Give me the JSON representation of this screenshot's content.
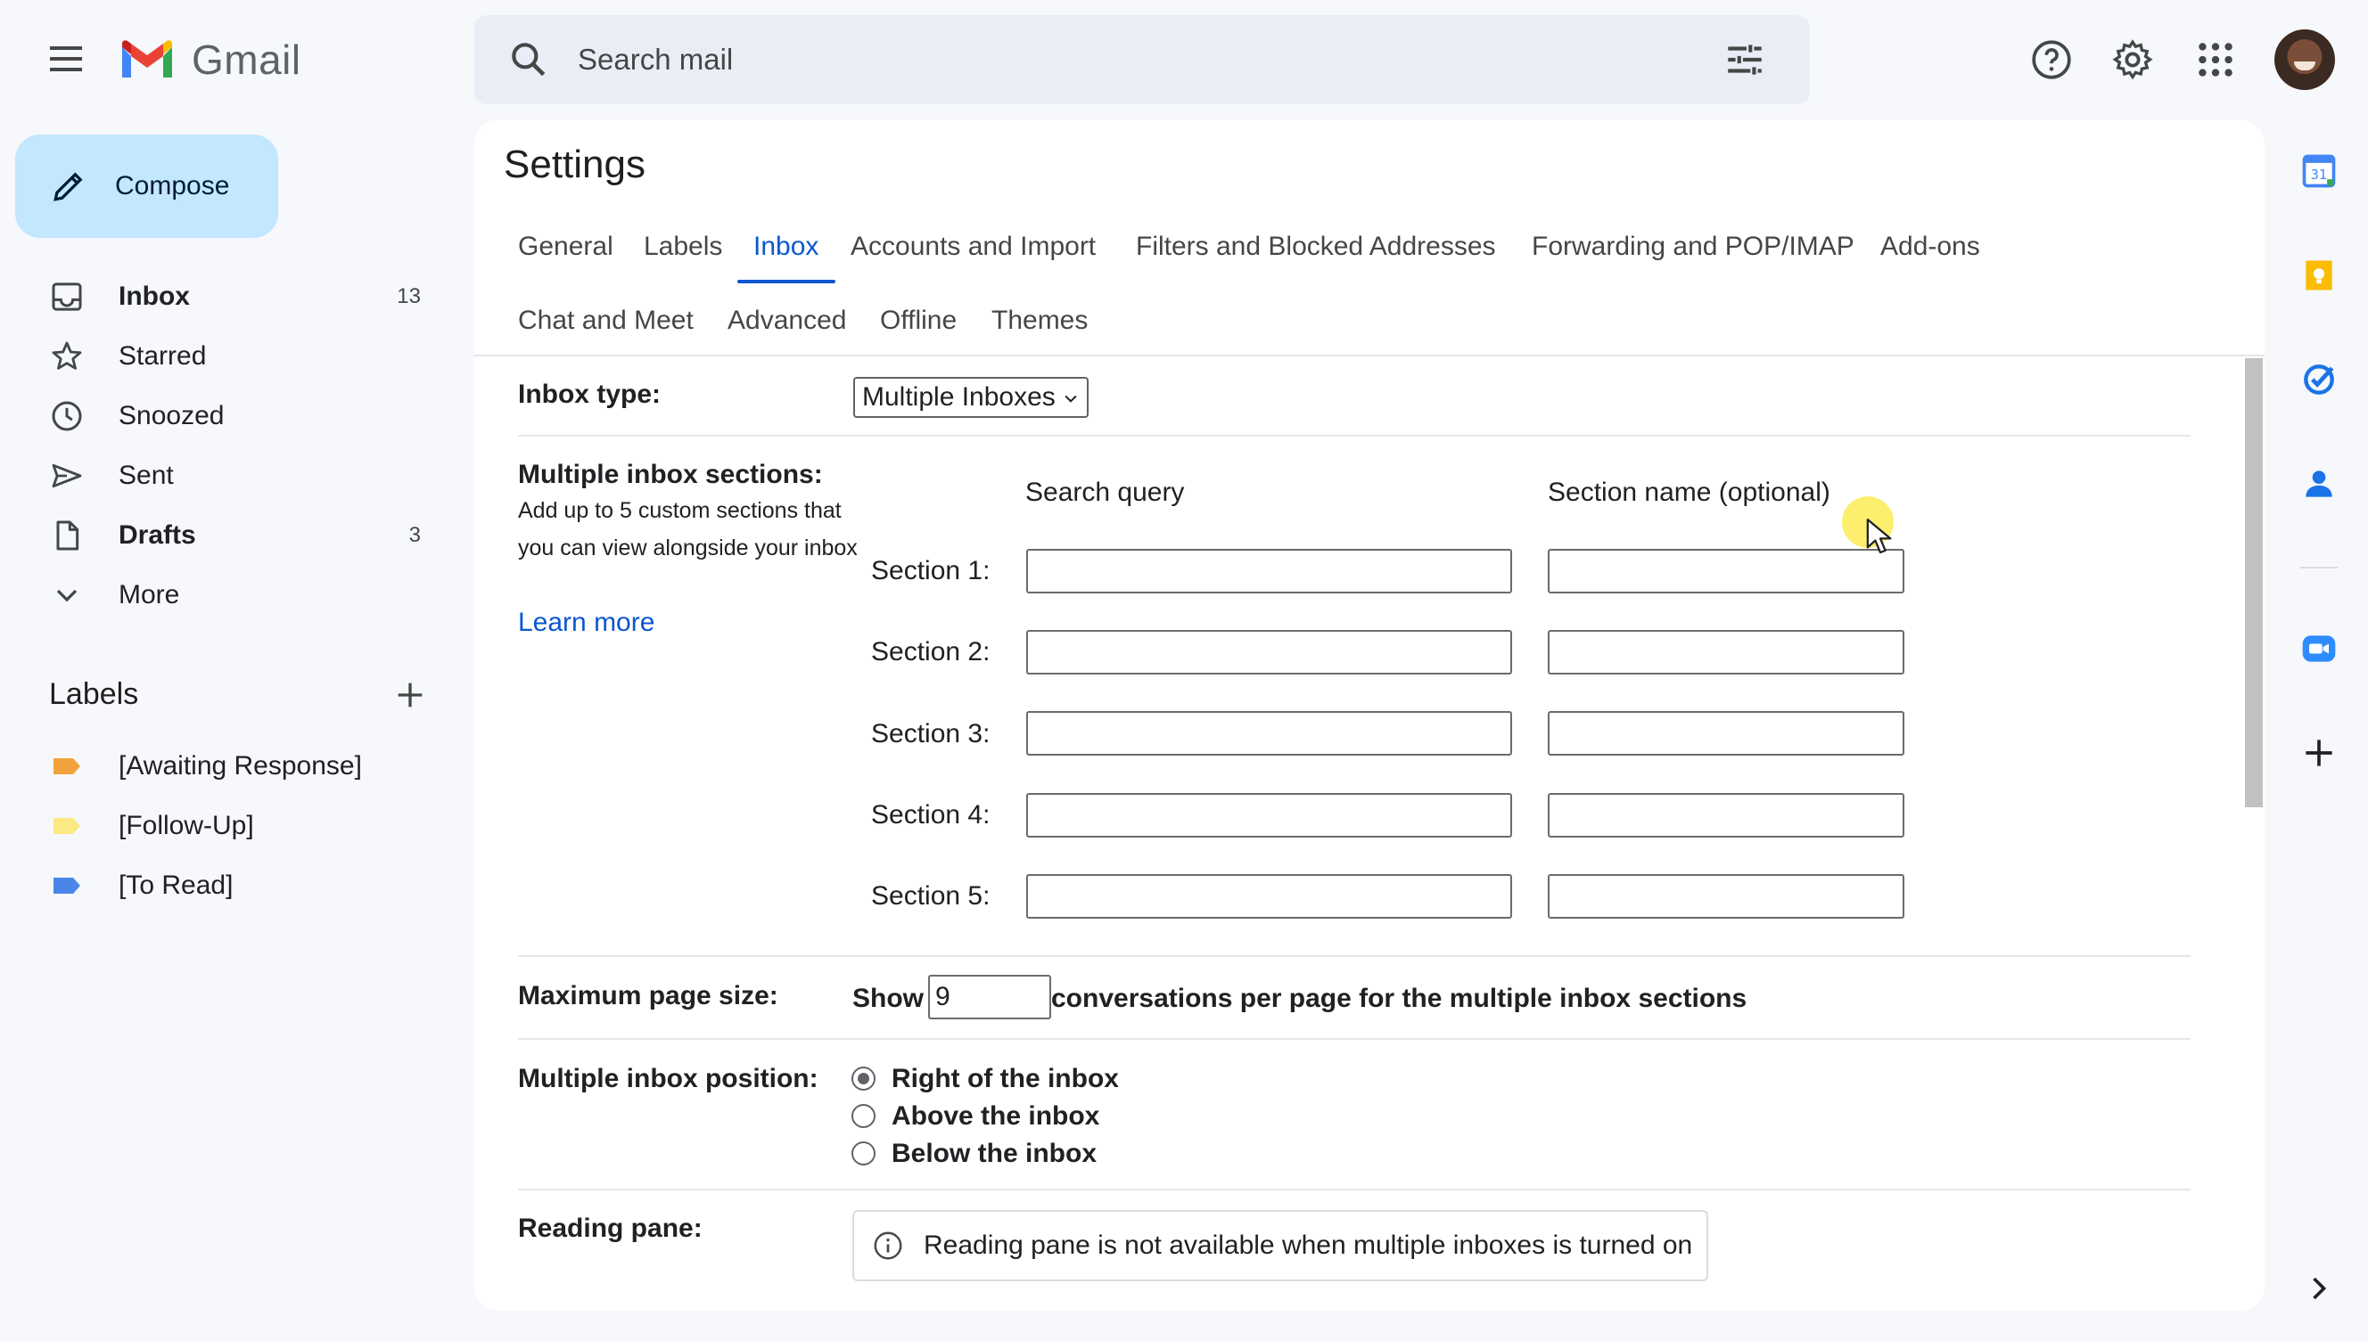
{
  "app": {
    "name": "Gmail"
  },
  "search": {
    "placeholder": "Search mail"
  },
  "compose": {
    "label": "Compose"
  },
  "nav": [
    {
      "label": "Inbox",
      "count": "13",
      "bold": true
    },
    {
      "label": "Starred",
      "count": ""
    },
    {
      "label": "Snoozed",
      "count": ""
    },
    {
      "label": "Sent",
      "count": ""
    },
    {
      "label": "Drafts",
      "count": "3",
      "bold": true
    },
    {
      "label": "More",
      "count": ""
    }
  ],
  "labels": {
    "title": "Labels",
    "items": [
      {
        "label": "[Awaiting Response]",
        "color": "#f2a23c"
      },
      {
        "label": "[Follow-Up]",
        "color": "#fbe983"
      },
      {
        "label": "[To Read]",
        "color": "#4a86e8"
      }
    ]
  },
  "settings": {
    "title": "Settings",
    "tabs": [
      "General",
      "Labels",
      "Inbox",
      "Accounts and Import",
      "Filters and Blocked Addresses",
      "Forwarding and POP/IMAP",
      "Add-ons",
      "Chat and Meet",
      "Advanced",
      "Offline",
      "Themes"
    ],
    "active_tab": "Inbox",
    "inbox_type": {
      "label": "Inbox type:",
      "value": "Multiple Inboxes"
    },
    "sections": {
      "label": "Multiple inbox sections:",
      "description": "Add up to 5 custom sections that you can view alongside your inbox",
      "learn_more": "Learn more",
      "col_query": "Search query",
      "col_name": "Section name (optional)",
      "rows": [
        "Section 1:",
        "Section 2:",
        "Section 3:",
        "Section 4:",
        "Section 5:"
      ]
    },
    "page_size": {
      "label": "Maximum page size:",
      "prefix": "Show",
      "value": "9",
      "suffix": "conversations per page for the multiple inbox sections"
    },
    "position": {
      "label": "Multiple inbox position:",
      "options": [
        "Right of the inbox",
        "Above the inbox",
        "Below the inbox"
      ],
      "selected": "Right of the inbox"
    },
    "reading_pane": {
      "label": "Reading pane:",
      "info": "Reading pane is not available when multiple inboxes is turned on"
    }
  },
  "colors": {
    "accent": "#0b57d0",
    "compose_bg": "#c2e7ff",
    "search_bg": "#e9eef6",
    "page_bg": "#f6f8fc"
  }
}
